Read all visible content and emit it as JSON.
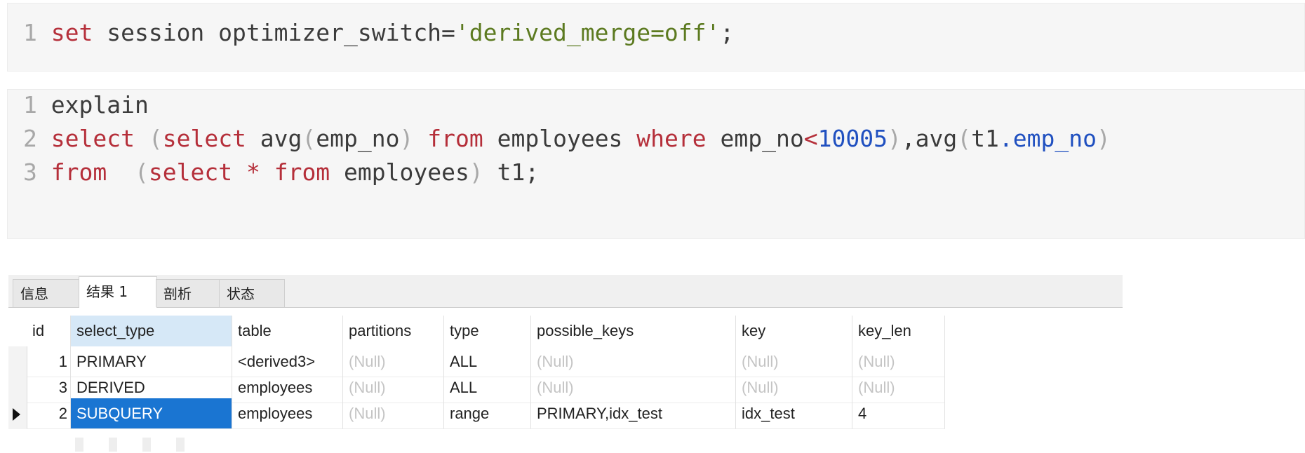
{
  "code_block_1": {
    "lines": [
      {
        "n": "1",
        "tokens": [
          {
            "t": "set",
            "c": "kw"
          },
          {
            "t": " session optimizer_switch=",
            "c": "pun"
          },
          {
            "t": "'derived_merge=off'",
            "c": "str"
          },
          {
            "t": ";",
            "c": "pun"
          }
        ]
      }
    ]
  },
  "code_block_2": {
    "lines": [
      {
        "n": "1",
        "tokens": [
          {
            "t": "explain",
            "c": "pun"
          }
        ]
      },
      {
        "n": "2",
        "tokens": [
          {
            "t": "select",
            "c": "kw"
          },
          {
            "t": " ",
            "c": "pun"
          },
          {
            "t": "(",
            "c": "ln"
          },
          {
            "t": "select",
            "c": "kw"
          },
          {
            "t": " avg",
            "c": "pun"
          },
          {
            "t": "(",
            "c": "ln"
          },
          {
            "t": "emp_no",
            "c": "pun"
          },
          {
            "t": ")",
            "c": "ln"
          },
          {
            "t": " ",
            "c": "pun"
          },
          {
            "t": "from",
            "c": "kw"
          },
          {
            "t": " employees ",
            "c": "pun"
          },
          {
            "t": "where",
            "c": "kw"
          },
          {
            "t": " emp_no",
            "c": "pun"
          },
          {
            "t": "<",
            "c": "kw"
          },
          {
            "t": "10005",
            "c": "num"
          },
          {
            "t": ")",
            "c": "ln"
          },
          {
            "t": ",avg",
            "c": "pun"
          },
          {
            "t": "(",
            "c": "ln"
          },
          {
            "t": "t1",
            "c": "pun"
          },
          {
            "t": ".emp_no",
            "c": "fld"
          },
          {
            "t": ")",
            "c": "ln"
          }
        ]
      },
      {
        "n": "3",
        "tokens": [
          {
            "t": "from",
            "c": "kw"
          },
          {
            "t": "  ",
            "c": "pun"
          },
          {
            "t": "(",
            "c": "ln"
          },
          {
            "t": "select",
            "c": "kw"
          },
          {
            "t": " ",
            "c": "pun"
          },
          {
            "t": "*",
            "c": "kw"
          },
          {
            "t": " ",
            "c": "pun"
          },
          {
            "t": "from",
            "c": "kw"
          },
          {
            "t": " employees",
            "c": "pun"
          },
          {
            "t": ")",
            "c": "ln"
          },
          {
            "t": " t1;",
            "c": "pun"
          }
        ]
      }
    ]
  },
  "tabs": {
    "info": "信息",
    "result": "结果 1",
    "profile": "剖析",
    "status": "状态"
  },
  "grid": {
    "columns": [
      "id",
      "select_type",
      "table",
      "partitions",
      "type",
      "possible_keys",
      "key",
      "key_len"
    ],
    "rows": [
      [
        "1",
        "PRIMARY",
        "<derived3>",
        "(Null)",
        "ALL",
        "(Null)",
        "(Null)",
        "(Null)"
      ],
      [
        "3",
        "DERIVED",
        "employees",
        "(Null)",
        "ALL",
        "(Null)",
        "(Null)",
        "(Null)"
      ],
      [
        "2",
        "SUBQUERY",
        "employees",
        "(Null)",
        "range",
        "PRIMARY,idx_test",
        "idx_test",
        "4"
      ]
    ]
  },
  "colors": {
    "keyword": "#b52f3a",
    "string": "#5c7a20",
    "number": "#2050c0",
    "selection": "#1a75d2"
  }
}
